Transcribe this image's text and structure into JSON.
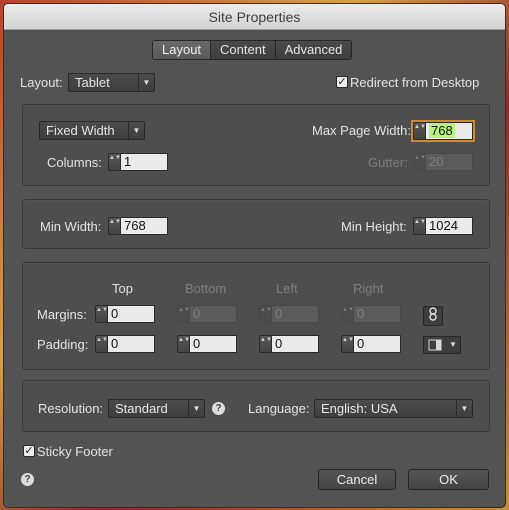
{
  "window": {
    "title": "Site Properties"
  },
  "tabs": [
    {
      "label": "Layout",
      "active": true
    },
    {
      "label": "Content",
      "active": false
    },
    {
      "label": "Advanced",
      "active": false
    }
  ],
  "layout": {
    "label": "Layout:",
    "selected": "Tablet",
    "redirect_label": "Redirect from Desktop",
    "redirect_checked": true
  },
  "width_panel": {
    "width_mode": "Fixed Width",
    "max_page_width_label": "Max Page Width:",
    "max_page_width": "768",
    "columns_label": "Columns:",
    "columns": "1",
    "gutter_label": "Gutter:",
    "gutter": "20"
  },
  "size_panel": {
    "min_width_label": "Min Width:",
    "min_width": "768",
    "min_height_label": "Min Height:",
    "min_height": "1024"
  },
  "spacing_panel": {
    "headers": {
      "top": "Top",
      "bottom": "Bottom",
      "left": "Left",
      "right": "Right"
    },
    "margins_label": "Margins:",
    "margins": {
      "top": "0",
      "bottom": "0",
      "left": "0",
      "right": "0"
    },
    "padding_label": "Padding:",
    "padding": {
      "top": "0",
      "bottom": "0",
      "left": "0",
      "right": "0"
    },
    "link_icon": "chain-link-icon",
    "padding_menu_icon": "padding-options-icon"
  },
  "resolution_panel": {
    "resolution_label": "Resolution:",
    "resolution": "Standard",
    "language_label": "Language:",
    "language": "English: USA"
  },
  "sticky_footer": {
    "label": "Sticky Footer",
    "checked": true
  },
  "buttons": {
    "cancel": "Cancel",
    "ok": "OK"
  },
  "glyphs": {
    "check": "✓",
    "help": "?",
    "arrow_down": "▼",
    "spin": "▲▼"
  }
}
